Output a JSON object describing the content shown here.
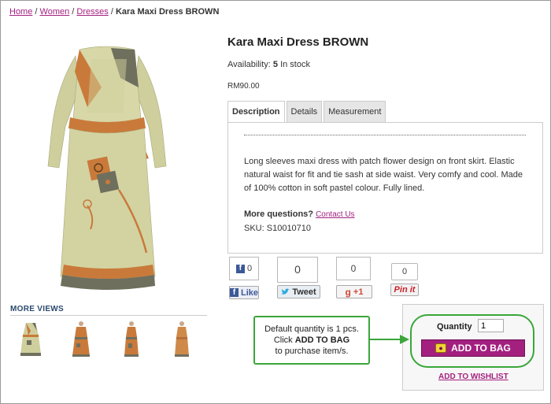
{
  "breadcrumb": {
    "home": "Home",
    "sep1": "/",
    "women": "Women",
    "sep2": "/",
    "dresses": "Dresses",
    "sep3": "/",
    "current": "Kara Maxi Dress BROWN"
  },
  "product": {
    "title": "Kara Maxi Dress BROWN",
    "availability_label": "Availability:",
    "availability_count": "5",
    "availability_text": "In stock",
    "price": "RM90.00",
    "sku_label": "SKU:",
    "sku_value": "S10010710"
  },
  "tabs": [
    {
      "label": "Description",
      "active": true
    },
    {
      "label": "Details",
      "active": false
    },
    {
      "label": "Measurement",
      "active": false
    }
  ],
  "description": {
    "text": "Long sleeves maxi dress with patch flower design on front skirt. Elastic natural waist for fit and tie sash at side waist. Very comfy and cool. Made of 100% cotton in soft pastel colour. Fully lined.",
    "more_questions": "More questions?",
    "contact_link": "Contact Us"
  },
  "more_views": {
    "title": "MORE VIEWS"
  },
  "social": {
    "facebook": {
      "count": "0",
      "label": "Like"
    },
    "twitter": {
      "count": "0",
      "label": "Tweet"
    },
    "google": {
      "count": "0",
      "label": "+1"
    },
    "pinterest": {
      "count": "0",
      "label": "Pin it"
    }
  },
  "cart": {
    "quantity_label": "Quantity",
    "quantity_value": "1",
    "add_to_bag": "ADD TO BAG",
    "add_to_wishlist": "ADD TO WISHLIST"
  },
  "callout": {
    "line1": "Default quantity is 1 pcs.",
    "line2_pre": "Click ",
    "line2_bold": "ADD TO BAG",
    "line3": "to purchase item/s."
  },
  "colors": {
    "link": "#a3207f",
    "highlight": "#3aa63a",
    "dress_beige": "#cfcf9e",
    "dress_orange": "#c97a3a",
    "dress_grey": "#6f6f5e"
  }
}
